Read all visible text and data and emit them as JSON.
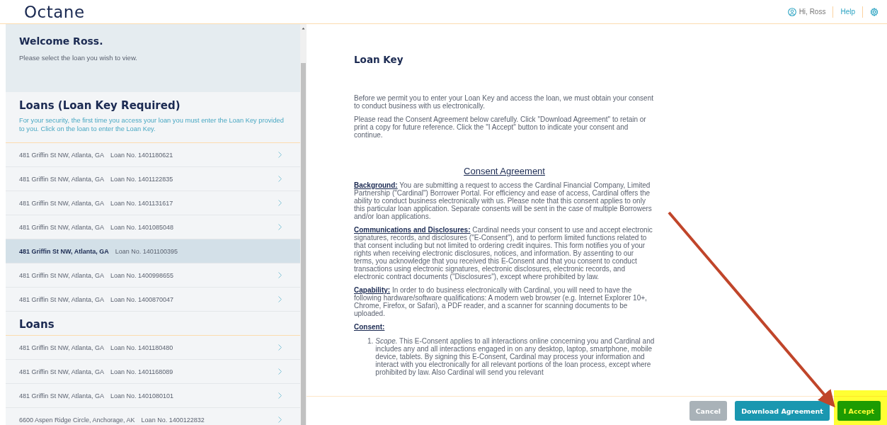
{
  "header": {
    "logo": "Octane",
    "greeting": "Hi, Ross",
    "help": "Help"
  },
  "sidebar": {
    "welcome_title": "Welcome Ross.",
    "welcome_text": "Please select the loan you wish to view.",
    "sections": [
      {
        "kind": "key",
        "title": "Loans (Loan Key Required)",
        "intro": "For your security, the first time you access your loan you must enter the Loan Key provided to you. Click on the loan to enter the Loan Key.",
        "loans": [
          {
            "address": "481 Griffin St NW, Atlanta, GA",
            "loan_no": "Loan No. 1401180621",
            "selected": false
          },
          {
            "address": "481 Griffin St NW, Atlanta, GA",
            "loan_no": "Loan No. 1401122835",
            "selected": false
          },
          {
            "address": "481 Griffin St NW, Atlanta, GA",
            "loan_no": "Loan No. 1401131617",
            "selected": false
          },
          {
            "address": "481 Griffin St NW, Atlanta, GA",
            "loan_no": "Loan No. 1401085048",
            "selected": false
          },
          {
            "address": "481 Griffin St NW, Atlanta, GA",
            "loan_no": "Loan No. 1401100395",
            "selected": true
          },
          {
            "address": "481 Griffin St NW, Atlanta, GA",
            "loan_no": "Loan No. 1400998655",
            "selected": false
          },
          {
            "address": "481 Griffin St NW, Atlanta, GA",
            "loan_no": "Loan No. 1400870047",
            "selected": false
          }
        ]
      },
      {
        "kind": "plain",
        "title": "Loans",
        "loans": [
          {
            "address": "481 Griffin St NW, Atlanta, GA",
            "loan_no": "Loan No. 1401180480",
            "selected": false
          },
          {
            "address": "481 Griffin St NW, Atlanta, GA",
            "loan_no": "Loan No. 1401168089",
            "selected": false
          },
          {
            "address": "481 Griffin St NW, Atlanta, GA",
            "loan_no": "Loan No. 1401080101",
            "selected": false
          },
          {
            "address": "6600 Aspen Ridge Circle, Anchorage, AK",
            "loan_no": "Loan No. 1400122832",
            "selected": false
          }
        ]
      }
    ]
  },
  "content": {
    "title": "Loan Key",
    "paragraphs": [
      "Before we permit you to enter your Loan Key and access the loan, we must obtain your consent to conduct business with us electronically.",
      "Please read the Consent Agreement below carefully. Click \"Download Agreement\" to retain or print a copy for future reference. Click the \"I Accept\" button to indicate your consent and continue."
    ],
    "agreement_title": "Consent Agreement",
    "clauses": [
      "**Background:** You are submitting a request to access the Cardinal Financial Company, Limited Partnership (\"Cardinal\") Borrower Portal. For efficiency and ease of access, Cardinal offers the ability to conduct business electronically with us. Please note that this consent applies to only this particular loan application. Separate consents will be sent in the case of multiple Borrowers and/or loan applications.",
      "**Communications and Disclosures:** Cardinal needs your consent to use and accept electronic signatures, records, and disclosures (\"E-Consent\"), and to perform limited functions related to that consent including but not limited to ordering credit inquires. This form notifies you of your rights when receiving electronic disclosures, notices, and information. By assenting to our terms, you acknowledge that you received this E-Consent and that you consent to conduct transactions using electronic signatures, electronic disclosures, electronic records, and electronic contract documents (\"Disclosures\"), except where prohibited by law.",
      "**Capability:** In order to do business electronically with Cardinal, you will need to have the following hardware/software qualifications: A modern web browser (e.g. Internet Explorer 10+, Chrome, Firefox, or Safari), a PDF reader, and a scanner for scanning documents to be uploaded."
    ],
    "consent_heading": "Consent:",
    "list_items": [
      {
        "number": "1.",
        "text": "*Scope.* This E-Consent applies to all interactions online concerning you and Cardinal and includes any and all interactions engaged in on any desktop, laptop, smartphone, mobile device, tablets. By signing this E-Consent, Cardinal may process your information and interact with you electronically for all relevant portions of the loan process, except where prohibited by law. Also Cardinal will send you relevant"
      }
    ]
  },
  "buttons": [
    {
      "label": "Cancel",
      "kind": "secondary",
      "disabled": true
    },
    {
      "label": "Download Agreement",
      "kind": "primary",
      "disabled": false
    },
    {
      "label": "I Accept",
      "kind": "accept",
      "disabled": false
    }
  ]
}
